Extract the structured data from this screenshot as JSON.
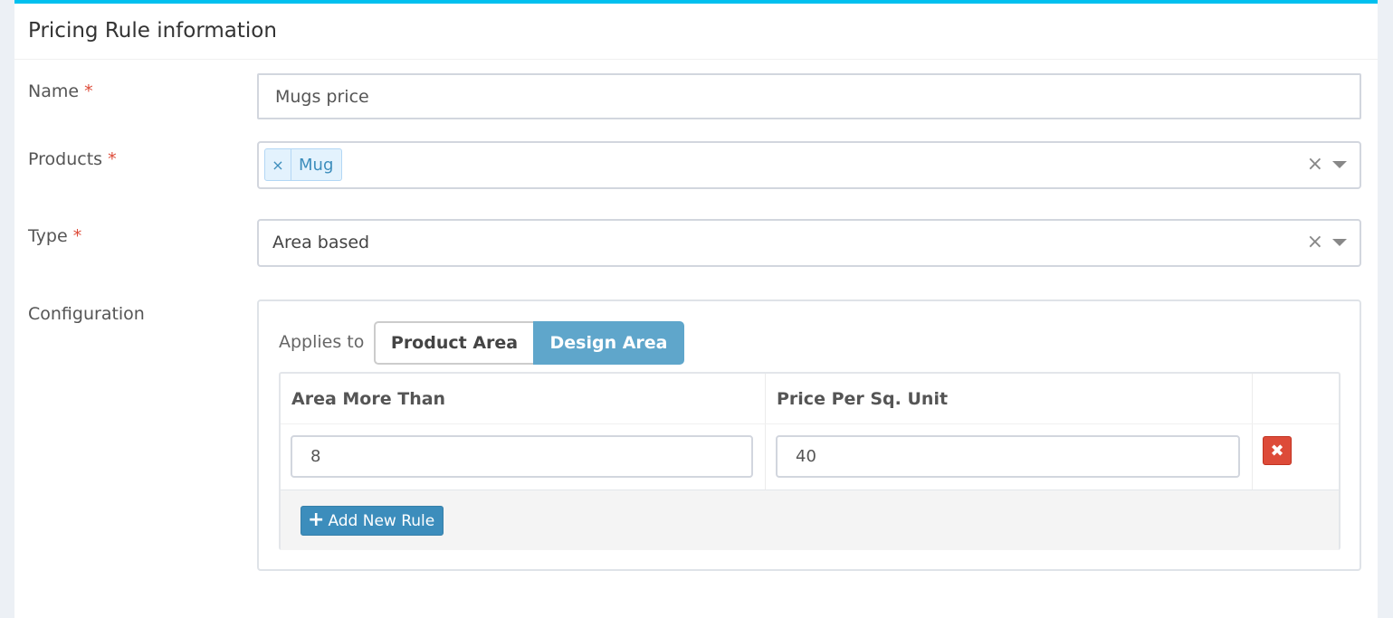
{
  "panel": {
    "title": "Pricing Rule information"
  },
  "form": {
    "required_marker": "*",
    "name": {
      "label": "Name",
      "value": "Mugs price"
    },
    "products": {
      "label": "Products",
      "tags": [
        {
          "label": "Mug",
          "remove": "×"
        }
      ],
      "clear": "×"
    },
    "type": {
      "label": "Type",
      "value": "Area based",
      "clear": "×"
    },
    "configuration": {
      "label": "Configuration",
      "applies_to_label": "Applies to",
      "options": [
        {
          "label": "Product Area",
          "selected": false
        },
        {
          "label": "Design Area",
          "selected": true
        }
      ],
      "table": {
        "columns": [
          "Area More Than",
          "Price Per Sq. Unit"
        ],
        "rows": [
          {
            "area_more_than": "8",
            "price_per_sq_unit": "40",
            "delete": "✖"
          }
        ]
      },
      "add_rule_label": "Add New Rule",
      "add_rule_icon": "+"
    }
  },
  "colors": {
    "accent_top": "#00c0ef",
    "selected_button": "#5fa6cb",
    "primary_button": "#3c8dbc",
    "danger": "#dd4b39"
  }
}
